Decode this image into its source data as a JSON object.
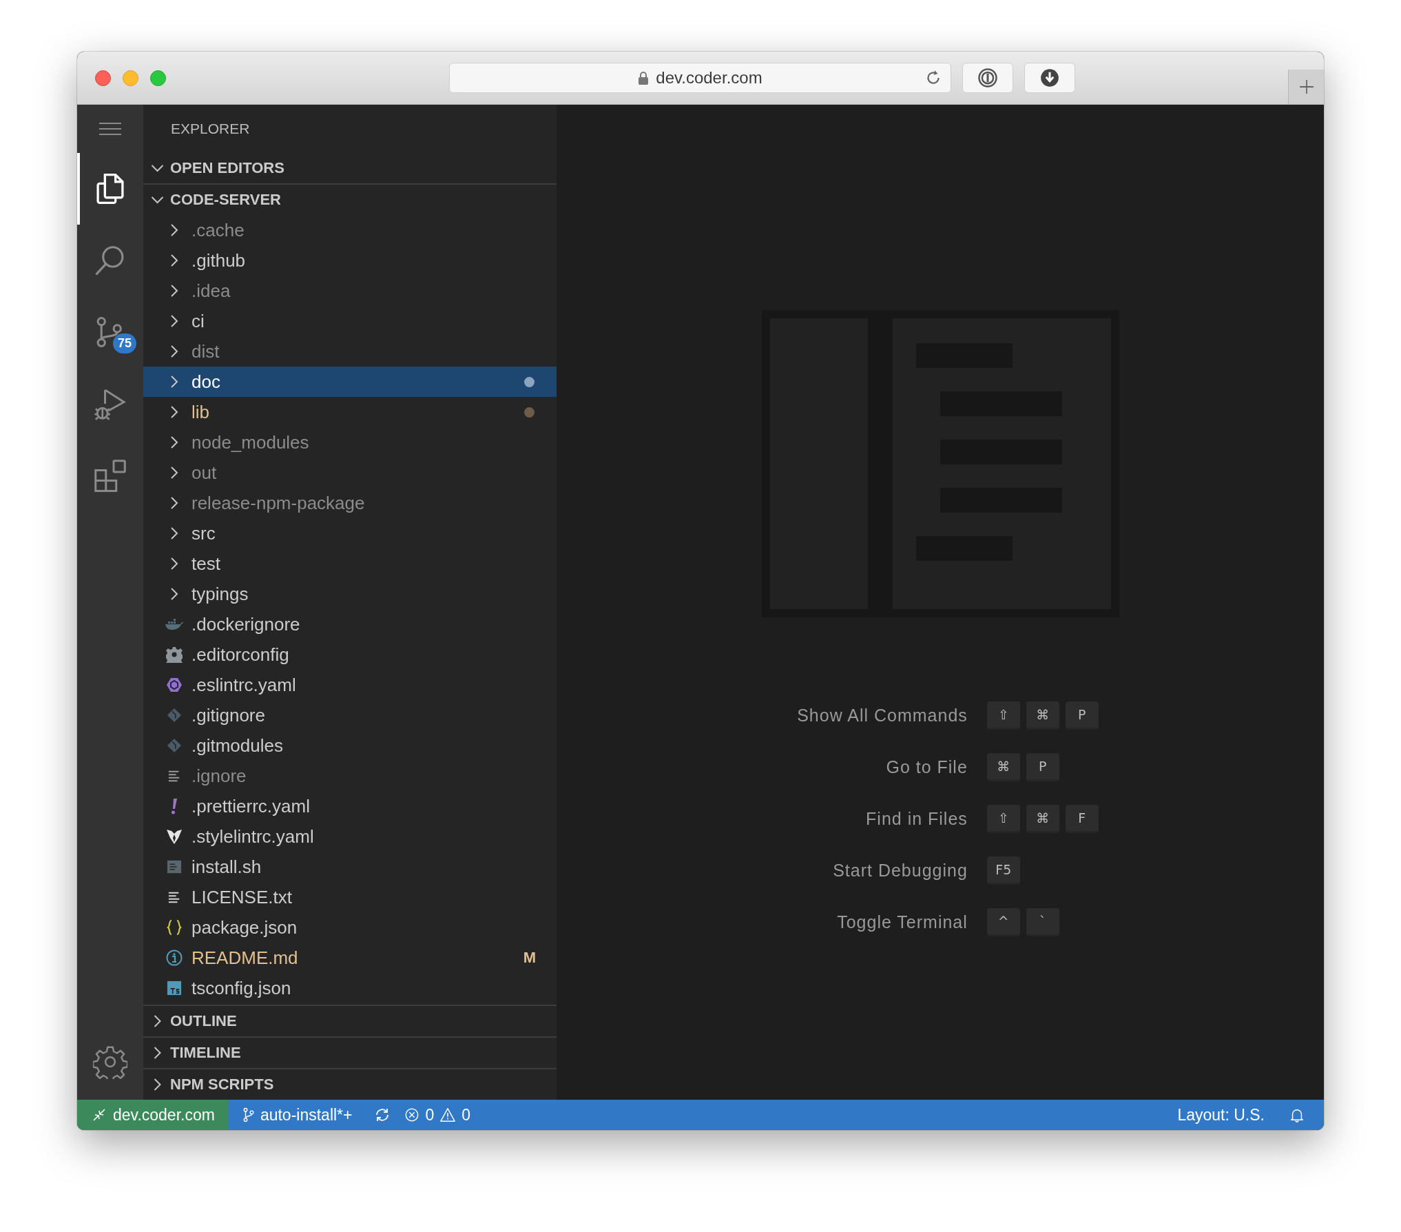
{
  "browser": {
    "url": "dev.coder.com"
  },
  "activity_bar": [
    {
      "kind": "explorer",
      "selected": true
    },
    {
      "kind": "search",
      "selected": false
    },
    {
      "kind": "source_control",
      "selected": false,
      "badge": "75"
    },
    {
      "kind": "run",
      "selected": false
    },
    {
      "kind": "extensions",
      "selected": false
    }
  ],
  "sidebar": {
    "title": "EXPLORER",
    "sections": [
      {
        "title": "OPEN EDITORS",
        "expanded": true
      },
      {
        "title": "CODE-SERVER",
        "expanded": true,
        "items": [
          {
            "name": ".cache",
            "kind": "folder",
            "selected": false,
            "dimmed": true,
            "modified": false
          },
          {
            "name": ".github",
            "kind": "folder",
            "selected": false,
            "dimmed": false,
            "modified": false
          },
          {
            "name": ".idea",
            "kind": "folder",
            "selected": false,
            "dimmed": true,
            "modified": false
          },
          {
            "name": "ci",
            "kind": "folder",
            "selected": false,
            "dimmed": false,
            "modified": false
          },
          {
            "name": "dist",
            "kind": "folder",
            "selected": false,
            "dimmed": true,
            "modified": false
          },
          {
            "name": "doc",
            "kind": "folder",
            "selected": true,
            "dimmed": false,
            "modified": true
          },
          {
            "name": "lib",
            "kind": "folder",
            "selected": false,
            "dimmed": false,
            "modified": true
          },
          {
            "name": "node_modules",
            "kind": "folder",
            "selected": false,
            "dimmed": true,
            "modified": false
          },
          {
            "name": "out",
            "kind": "folder",
            "selected": false,
            "dimmed": true,
            "modified": false
          },
          {
            "name": "release-npm-package",
            "kind": "folder",
            "selected": false,
            "dimmed": true,
            "modified": false
          },
          {
            "name": "src",
            "kind": "folder",
            "selected": false,
            "dimmed": false,
            "modified": false
          },
          {
            "name": "test",
            "kind": "folder",
            "selected": false,
            "dimmed": false,
            "modified": false
          },
          {
            "name": "typings",
            "kind": "folder",
            "selected": false,
            "dimmed": false,
            "modified": false
          },
          {
            "name": ".dockerignore",
            "kind": "docker",
            "selected": false,
            "dimmed": false,
            "modified": false
          },
          {
            "name": ".editorconfig",
            "kind": "config",
            "selected": false,
            "dimmed": false,
            "modified": false
          },
          {
            "name": ".eslintrc.yaml",
            "kind": "eslint",
            "selected": false,
            "dimmed": false,
            "modified": false
          },
          {
            "name": ".gitignore",
            "kind": "git",
            "selected": false,
            "dimmed": false,
            "modified": false
          },
          {
            "name": ".gitmodules",
            "kind": "git",
            "selected": false,
            "dimmed": false,
            "modified": false
          },
          {
            "name": ".ignore",
            "kind": "text",
            "selected": false,
            "dimmed": true,
            "modified": false
          },
          {
            "name": ".prettierrc.yaml",
            "kind": "prettier",
            "selected": false,
            "dimmed": false,
            "modified": false
          },
          {
            "name": ".stylelintrc.yaml",
            "kind": "stylelint",
            "selected": false,
            "dimmed": false,
            "modified": false
          },
          {
            "name": "install.sh",
            "kind": "shell",
            "selected": false,
            "dimmed": false,
            "modified": false
          },
          {
            "name": "LICENSE.txt",
            "kind": "text",
            "selected": false,
            "dimmed": false,
            "modified": false
          },
          {
            "name": "package.json",
            "kind": "json",
            "selected": false,
            "dimmed": false,
            "modified": false
          },
          {
            "name": "README.md",
            "kind": "markdown",
            "selected": false,
            "dimmed": false,
            "modified": true,
            "badge": "M"
          },
          {
            "name": "tsconfig.json",
            "kind": "typescript",
            "selected": false,
            "dimmed": false,
            "modified": false
          }
        ]
      },
      {
        "title": "OUTLINE",
        "expanded": false
      },
      {
        "title": "TIMELINE",
        "expanded": false
      },
      {
        "title": "NPM SCRIPTS",
        "expanded": false
      }
    ]
  },
  "editor": {
    "shortcuts": [
      {
        "label": "Show All Commands",
        "keys": [
          "⇧",
          "⌘",
          "P"
        ]
      },
      {
        "label": "Go to File",
        "keys": [
          "⌘",
          "P"
        ]
      },
      {
        "label": "Find in Files",
        "keys": [
          "⇧",
          "⌘",
          "F"
        ]
      },
      {
        "label": "Start Debugging",
        "keys": [
          "F5"
        ]
      },
      {
        "label": "Toggle Terminal",
        "keys": [
          "^",
          "`"
        ]
      }
    ]
  },
  "status_bar": {
    "remote": "dev.coder.com",
    "branch": "auto-install*+",
    "errors": "0",
    "warnings": "0",
    "layout": "Layout: U.S."
  }
}
